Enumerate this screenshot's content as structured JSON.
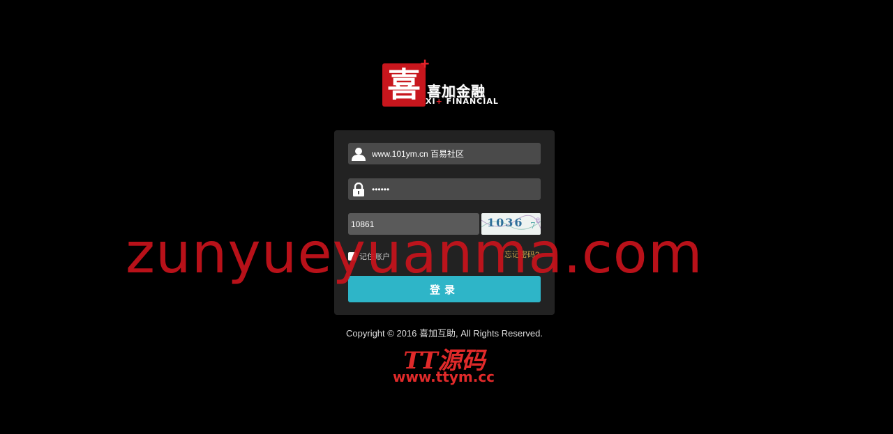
{
  "logo": {
    "mark_glyph": "喜",
    "plus_glyph": "+",
    "name": "喜加金融",
    "en_prefix": "XI",
    "en_plus": "+",
    "en_suffix": " FINANCIAL",
    "brand_color": "#c8161d"
  },
  "login": {
    "username_value": "www.101ym.cn 百易社区",
    "password_value": "••••••",
    "captcha_value": "10861",
    "captcha_image_text": "1036",
    "remember_label": "记住账户",
    "forgot_label": "忘记密码?",
    "submit_label": "登录",
    "accent_color": "#2eb5c8"
  },
  "footer": {
    "copyright": "Copyright © 2016 喜加互助, All Rights Reserved."
  },
  "watermarks": {
    "big": "zunyueyuanma.com",
    "tt": "TT源码",
    "url": "www.ttym.cc"
  },
  "icons": {
    "user": "user-icon",
    "lock": "lock-icon"
  }
}
